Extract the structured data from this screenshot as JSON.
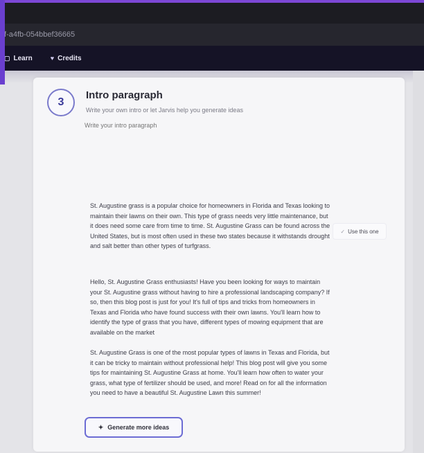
{
  "browser": {
    "url_fragment": "f-a4fb-054bbef36665"
  },
  "nav": {
    "items": [
      {
        "icon": "book-icon",
        "glyph": "▢",
        "label": "Learn"
      },
      {
        "icon": "heart-icon",
        "glyph": "♥",
        "label": "Credits"
      }
    ]
  },
  "step": {
    "number": "3",
    "title": "Intro paragraph",
    "subtitle": "Write your own intro or let Jarvis help you generate ideas",
    "input_placeholder": "Write your intro paragraph"
  },
  "ideas": [
    {
      "text": "St. Augustine grass is a popular choice for homeowners in Florida and Texas looking to maintain their lawns on their own. This type of grass needs very little maintenance, but it does need some care from time to time. St. Augustine Grass can be found across the United States, but is most often used in these two states because it withstands drought and salt better than other types of turfgrass.",
      "use_label": "Use this one"
    },
    {
      "text": "Hello, St. Augustine Grass enthusiasts! Have you been looking for ways to maintain your St. Augustine grass without having to hire a professional landscaping company? If so, then this blog post is just for you! It's full of tips and tricks from homeowners in Texas and Florida who have found success with their own lawns. You'll learn how to identify the type of grass that you have, different types of mowing equipment that are available on the market"
    },
    {
      "text": "St. Augustine Grass is one of the most popular types of lawns in Texas and Florida, but it can be tricky to maintain without professional help! This blog post will give you some tips for maintaining St. Augustine Grass at home. You'll learn how often to water your grass, what type of fertilizer should be used, and more! Read on for all the information you need to have a beautiful St. Augustine Lawn this summer!"
    }
  ],
  "generate_more": {
    "icon": "sparkle-icon",
    "glyph": "✦",
    "label": "Generate more ideas"
  },
  "colors": {
    "accent": "#6c6cd4",
    "nav_bg": "#151326",
    "brand_purple": "#7d48d6"
  }
}
